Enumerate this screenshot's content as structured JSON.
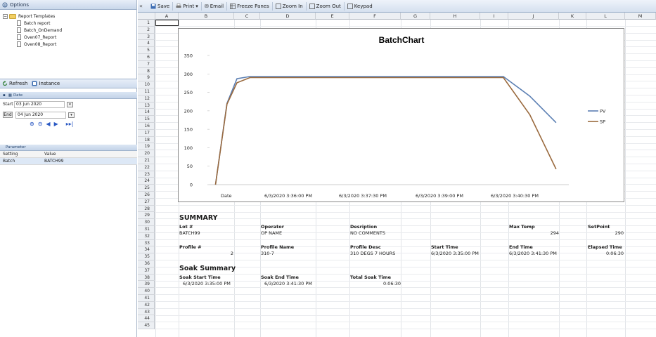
{
  "left_pane": {
    "header": "Options",
    "tree": {
      "root": "Report Templates",
      "root_expander": "−",
      "items": [
        "Batch report",
        "Batch_OnDemand",
        "Oven07_Report",
        "Oven08_Report"
      ]
    },
    "refresh_label": "Refresh",
    "instance_label": "Instance",
    "date_section": "Date",
    "start_label": "Start",
    "start_value": "03 Jun 2020",
    "end_label": "End",
    "end_value": "04 Jun 2020",
    "parameter_section": "Parameter",
    "param_headers": {
      "setting": "Setting",
      "value": "Value"
    },
    "params": [
      {
        "setting": "Batch",
        "value": "BATCH99"
      }
    ]
  },
  "toolbar": {
    "collapse": "«",
    "save": "Save",
    "print": "Print",
    "email": "Email",
    "freeze": "Freeze Panes",
    "zoom_in": "Zoom In",
    "zoom_out": "Zoom Out",
    "keypad": "Keypad"
  },
  "sheet": {
    "columns": [
      "A",
      "B",
      "C",
      "D",
      "E",
      "F",
      "G",
      "H",
      "I",
      "J",
      "K",
      "L",
      "M"
    ],
    "rows": [
      "1",
      "2",
      "3",
      "4",
      "5",
      "6",
      "7",
      "8",
      "9",
      "10",
      "11",
      "12",
      "13",
      "14",
      "15",
      "16",
      "17",
      "18",
      "19",
      "20",
      "21",
      "22",
      "23",
      "24",
      "25",
      "26",
      "27",
      "28",
      "29",
      "30",
      "31",
      "32",
      "33",
      "34",
      "35",
      "36",
      "37",
      "38",
      "39",
      "40",
      "41",
      "42",
      "43",
      "44",
      "45"
    ]
  },
  "chart_data": {
    "type": "line",
    "title": "BatchChart",
    "x": [
      "Date",
      "6/3/2020 3:36:00 PM",
      "6/3/2020 3:37:30 PM",
      "6/3/2020 3:39:00 PM",
      "6/3/2020 3:40:30 PM"
    ],
    "yticks": [
      0,
      50,
      100,
      150,
      200,
      250,
      300,
      350
    ],
    "ylim": [
      0,
      350
    ],
    "legend_position": "right",
    "series": [
      {
        "name": "PV",
        "color": "#5b7fb3",
        "points": [
          [
            0.05,
            0
          ],
          [
            0.2,
            220
          ],
          [
            0.33,
            287
          ],
          [
            0.5,
            293
          ],
          [
            1.0,
            293
          ],
          [
            3.85,
            293
          ],
          [
            4.2,
            240
          ],
          [
            4.55,
            168
          ]
        ]
      },
      {
        "name": "SP",
        "color": "#9a6a3e",
        "points": [
          [
            0.05,
            0
          ],
          [
            0.2,
            218
          ],
          [
            0.33,
            276
          ],
          [
            0.5,
            290
          ],
          [
            1.0,
            290
          ],
          [
            3.85,
            290
          ],
          [
            4.2,
            190
          ],
          [
            4.55,
            42
          ]
        ]
      }
    ]
  },
  "summary": {
    "title": "SUMMARY",
    "lot_label": "Lot #",
    "lot": "BATCH99",
    "operator_label": "Operator",
    "operator": "OP NAME",
    "desc_label": "Desription",
    "desc": "NO COMMENTS",
    "maxtemp_label": "Max Temp",
    "maxtemp": "294",
    "setpoint_label": "SetPoint",
    "setpoint": "290",
    "profile_label": "Profile #",
    "profile": "2",
    "profile_name_label": "Profile Name",
    "profile_name": "310-7",
    "profile_desc_label": "Profile Desc",
    "profile_desc": "310 DEGS 7 HOURS",
    "start_label": "Start Time",
    "start": "6/3/2020 3:35:00 PM",
    "end_label": "End Time",
    "end": "6/3/2020 3:41:30 PM",
    "elapsed_label": "Elapsed Time",
    "elapsed": "0:06:30"
  },
  "soak": {
    "title": "Soak Summary",
    "start_label": "Soak Start Time",
    "start": "6/3/2020 3:35:00 PM",
    "end_label": "Soak End Time",
    "end": "6/3/2020 3:41:30 PM",
    "total_label": "Total Soak Time",
    "total": "0:06:30"
  }
}
